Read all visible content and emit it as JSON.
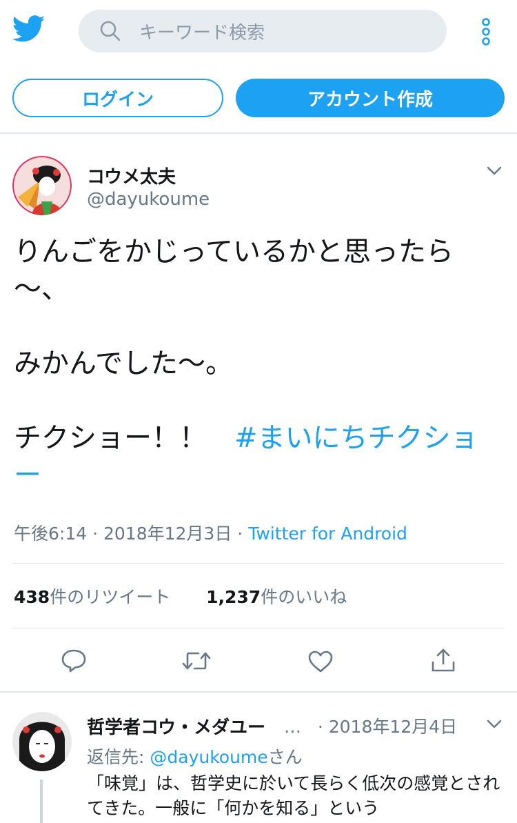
{
  "header": {
    "search_placeholder": "キーワード検索",
    "login_label": "ログイン",
    "signup_label": "アカウント作成"
  },
  "tweet": {
    "display_name": "コウメ太夫",
    "handle": "@dayukoume",
    "text_lines": "りんごをかじっているかと思ったら\n〜、\n\nみかんでした〜。\n\nチクショー！！　",
    "hashtag": "#まいにちチクショー",
    "time": "午後6:14",
    "date": "2018年12月3日",
    "source": "Twitter for Android",
    "retweet_count": "438",
    "retweet_label": "件のリツイート",
    "like_count": "1,237",
    "like_label": "件のいいね"
  },
  "reply": {
    "display_name": "哲学者コウ・メダユー",
    "ellipsis": "…",
    "date": "2018年12月4日",
    "reply_to_prefix": "返信先: ",
    "reply_to_mention": "@dayukoume",
    "reply_to_suffix": "さん",
    "text": "「味覚」は、哲学史に於いて長らく低次の感覚とされてきた。一般に「何かを知る」という"
  },
  "colors": {
    "brand": "#1da1f2",
    "secondary_text": "#657786",
    "divider": "#e1e8ed"
  },
  "icons": [
    "twitter-bird-icon",
    "search-icon",
    "more-vertical-icon",
    "chevron-down-icon",
    "reply-icon",
    "retweet-icon",
    "like-icon",
    "share-icon"
  ]
}
